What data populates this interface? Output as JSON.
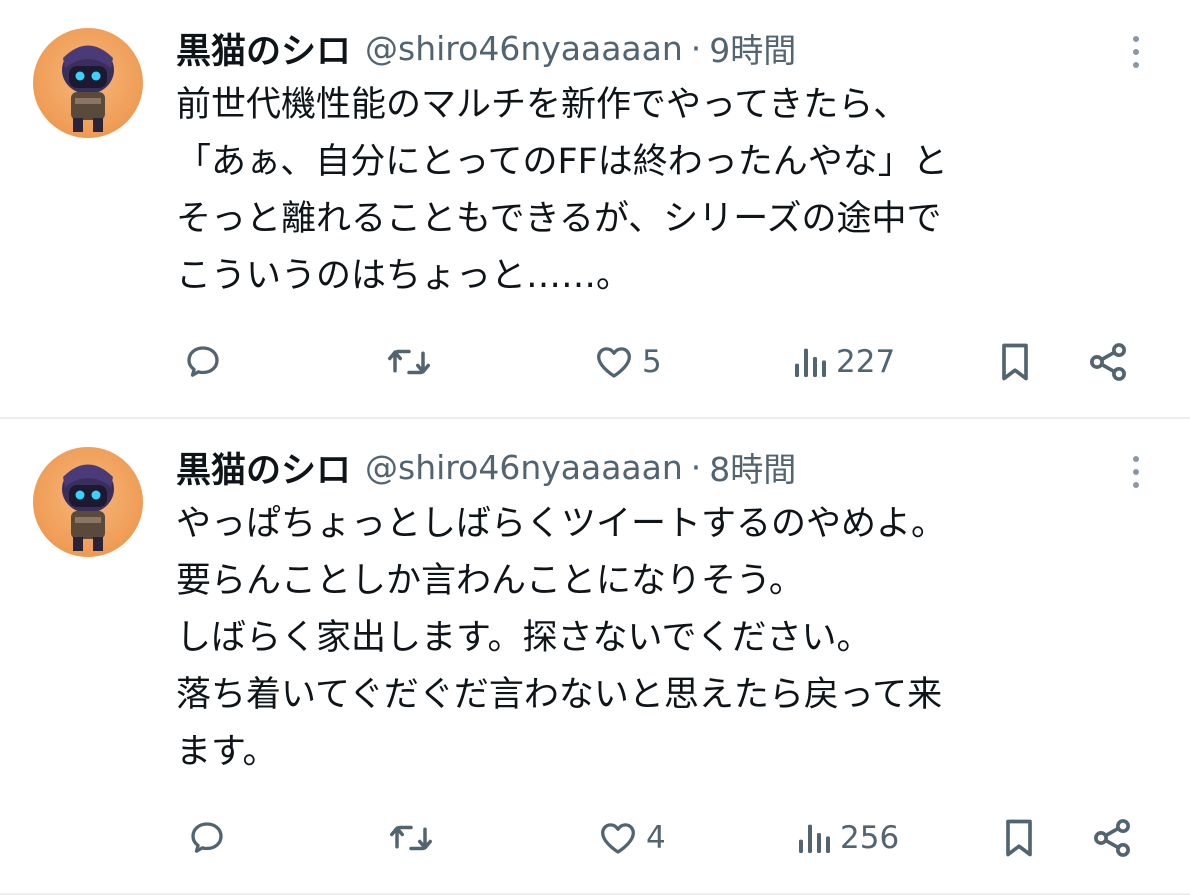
{
  "tweets": [
    {
      "name": "黒猫のシロ",
      "handle": "@shiro46nyaaaaan",
      "separator": "·",
      "time": "9時間",
      "text": "前世代機性能のマルチを新作でやってきたら、\n「あぁ、自分にとってのFFは終わったんやな」と\nそっと離れることもできるが、シリーズの途中で\nこういうのはちょっと……。",
      "likes": "5",
      "views": "227"
    },
    {
      "name": "黒猫のシロ",
      "handle": "@shiro46nyaaaaan",
      "separator": "·",
      "time": "8時間",
      "text": "やっぱちょっとしばらくツイートするのやめよ。\n要らんことしか言わんことになりそう。\nしばらく家出します。探さないでください。\n落ち着いてぐだぐだ言わないと思えたら戻って来\nます。",
      "likes": "4",
      "views": "256"
    }
  ],
  "icons": {
    "reply": "reply-icon",
    "retweet": "retweet-icon",
    "like": "heart-icon",
    "views": "views-icon",
    "bookmark": "bookmark-icon",
    "share": "share-icon",
    "more": "more-icon"
  },
  "colors": {
    "text": "#0f1419",
    "secondary": "#536471",
    "divider": "#eceef0",
    "avatar_bg": "#f0a05a"
  }
}
